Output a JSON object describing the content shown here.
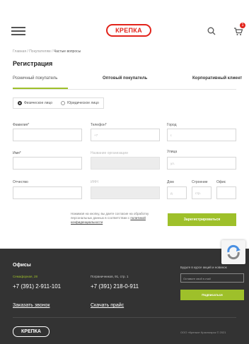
{
  "header": {
    "logo_text": "КРЕПКА",
    "cart_count": "1"
  },
  "breadcrumb": {
    "home": "Главная",
    "sep1": " / ",
    "section": "Покупателям",
    "sep2": " / ",
    "current": "Частые вопросы"
  },
  "page": {
    "title": "Регистрация"
  },
  "tabs": [
    {
      "label": "Розничный покупатель"
    },
    {
      "label": "Оптовый покупатель"
    },
    {
      "label": "Корпоративный клиент"
    }
  ],
  "person_type": [
    {
      "label": "Физическое лицо"
    },
    {
      "label": "Юридическое лицо"
    }
  ],
  "form": {
    "lastname_label": "Фамилия*",
    "phone_label": "Телефон*",
    "city_label": "Город",
    "firstname_label": "Имя*",
    "org_label": "Название организации",
    "street_label": "Улица",
    "patronymic_label": "Отчество",
    "inn_label": "ИНН",
    "house_label": "Дом",
    "building_label": "Строение",
    "office_label": "Офис",
    "phone_placeholder": "+7",
    "city_placeholder": "г.",
    "street_placeholder": "ул.",
    "house_placeholder": "д.",
    "building_placeholder": "стр."
  },
  "consent": {
    "text": "Нажимая на кнопку, вы даете согласие на обработку персональных данных в соответствии с ",
    "link": "политикой конфиденциальности"
  },
  "submit_label": "Зарегистрироваться",
  "footer": {
    "offices_title": "Офисы",
    "address1": "Семафорная, 28",
    "address2": "Пограничников, 91, стр. 1",
    "phone1": "+7 (391) 2-911-101",
    "phone2": "+7 (391) 218-0-911",
    "callback_link": "Заказать звонок",
    "price_link": "Скачать прайс",
    "subscribe_text": "Будьте в курсе акций и новинок",
    "email_placeholder": "Оставьте свой e-mail",
    "subscribe_btn": "Подписаться",
    "logo_text": "КРЕПКА",
    "copyright": "ООО «Крепка» Красноярск © 2021"
  },
  "colors": {
    "accent_green": "#9ec02a",
    "brand_red": "#e2231a",
    "footer_bg": "#333333"
  }
}
